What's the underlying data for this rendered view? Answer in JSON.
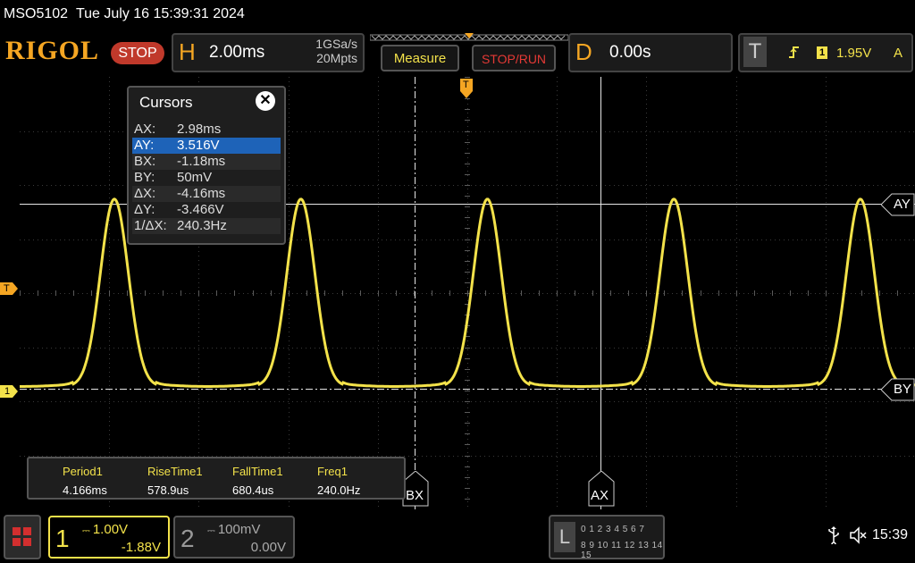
{
  "status": {
    "model": "MSO5102",
    "datetime": "Tue July 16 15:39:31 2024"
  },
  "toolbar": {
    "brand": "RIGOL",
    "run_state": "STOP",
    "horizontal": {
      "label": "H",
      "timebase": "2.00ms",
      "sample_rate": "1GSa/s",
      "memory_depth": "20Mpts"
    },
    "measure_button": "Measure",
    "stoprun_button": "STOP/RUN",
    "delay": {
      "label": "D",
      "value": "0.00s"
    },
    "trigger": {
      "label": "T",
      "source": "1",
      "level": "1.95V",
      "mode": "A"
    }
  },
  "markers": {
    "trigger": "T",
    "trigger_level": "T",
    "ch1_ground": "1"
  },
  "cursors": {
    "title": "Cursors",
    "close_glyph": "✕",
    "rows": [
      {
        "key": "AX:",
        "value": "2.98ms"
      },
      {
        "key": "AY:",
        "value": "3.516V",
        "selected": true
      },
      {
        "key": "BX:",
        "value": "-1.18ms"
      },
      {
        "key": "BY:",
        "value": "50mV"
      },
      {
        "key": "ΔX:",
        "value": "-4.16ms"
      },
      {
        "key": "ΔY:",
        "value": "-3.466V"
      },
      {
        "key": "1/ΔX:",
        "value": "240.3Hz"
      }
    ],
    "tags": {
      "ay": "AY",
      "by": "BY",
      "ax": "AX",
      "bx": "BX"
    }
  },
  "measurements": [
    {
      "name": "Period1",
      "value": "4.166ms"
    },
    {
      "name": "RiseTime1",
      "value": "578.9us"
    },
    {
      "name": "FallTime1",
      "value": "680.4us"
    },
    {
      "name": "Freq1",
      "value": "240.0Hz"
    }
  ],
  "channels": {
    "ch1": {
      "num": "1",
      "scale": "1.00V",
      "offset": "-1.88V"
    },
    "ch2": {
      "num": "2",
      "scale": "100mV",
      "offset": "0.00V"
    }
  },
  "logic": {
    "label": "L",
    "row1": "0 1 2 3   4 5 6 7",
    "row2": "8 9 10 11  12 13 14 15"
  },
  "system": {
    "clock": "15:39"
  },
  "waveform": {
    "color": "#f3e24a",
    "period_ms": 4.166,
    "peak_v": 3.516,
    "base_v": 0.05,
    "ch1_offset_v": -1.88,
    "volts_per_div": 1.0,
    "time_per_div_ms": 2.0
  },
  "colors": {
    "accent": "#f5a623",
    "stop": "#c0392b",
    "trace": "#f3e24a",
    "selection": "#1e63b8"
  }
}
